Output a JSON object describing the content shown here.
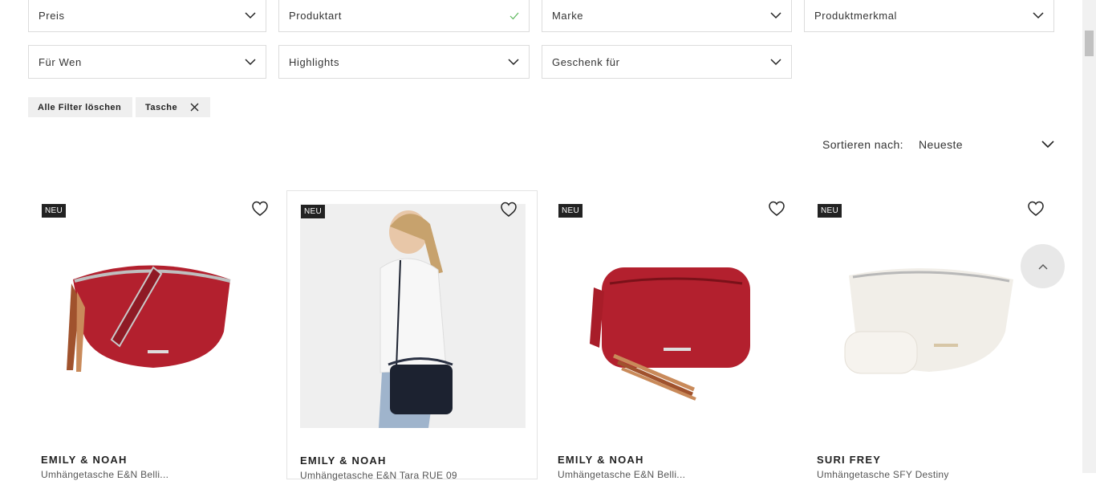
{
  "filters": {
    "row1": [
      "Preis",
      "Produktart",
      "Marke",
      "Produktmerkmal"
    ],
    "row2": [
      "Für Wen",
      "Highlights",
      "Geschenk für"
    ]
  },
  "chips": {
    "clear_all": "Alle Filter löschen",
    "active": "Tasche"
  },
  "sort": {
    "label": "Sortieren nach:",
    "value": "Neueste"
  },
  "products": [
    {
      "badge": "NEU",
      "brand": "EMILY & NOAH",
      "subtitle": "Umhängetasche E&N Belli..."
    },
    {
      "badge": "NEU",
      "brand": "EMILY & NOAH",
      "subtitle": "Umhängetasche E&N Tara RUE 09"
    },
    {
      "badge": "NEU",
      "brand": "EMILY & NOAH",
      "subtitle": "Umhängetasche E&N Belli..."
    },
    {
      "badge": "NEU",
      "brand": "SURI FREY",
      "subtitle": "Umhängetasche SFY Destiny"
    }
  ],
  "icons": {
    "chevron": "chevron-down-icon",
    "check": "check-icon",
    "close": "close-icon",
    "heart": "heart-icon",
    "up": "chevron-up-icon"
  },
  "colors": {
    "check": "#5cb85c",
    "bag_red": "#b3202e",
    "bag_white": "#f1eee8",
    "bag_black": "#1c2230",
    "badge": "#222222"
  }
}
